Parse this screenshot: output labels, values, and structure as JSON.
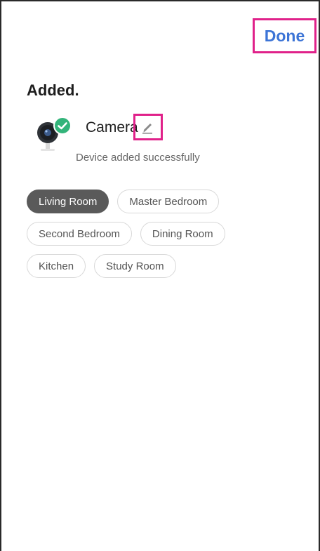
{
  "header": {
    "done_label": "Done"
  },
  "page": {
    "title": "Added."
  },
  "device": {
    "name": "Camera",
    "status": "Device added successfully",
    "icon": "camera-icon",
    "status_icon": "check-circle-icon",
    "edit_icon": "pencil-icon"
  },
  "rooms": [
    {
      "label": "Living Room",
      "selected": true
    },
    {
      "label": "Master Bedroom",
      "selected": false
    },
    {
      "label": "Second Bedroom",
      "selected": false
    },
    {
      "label": "Dining Room",
      "selected": false
    },
    {
      "label": "Kitchen",
      "selected": false
    },
    {
      "label": "Study Room",
      "selected": false
    }
  ],
  "colors": {
    "accent": "#3c74d6",
    "highlight_box": "#e0218a",
    "success": "#33b47a",
    "chip_selected": "#5a5a5a"
  }
}
